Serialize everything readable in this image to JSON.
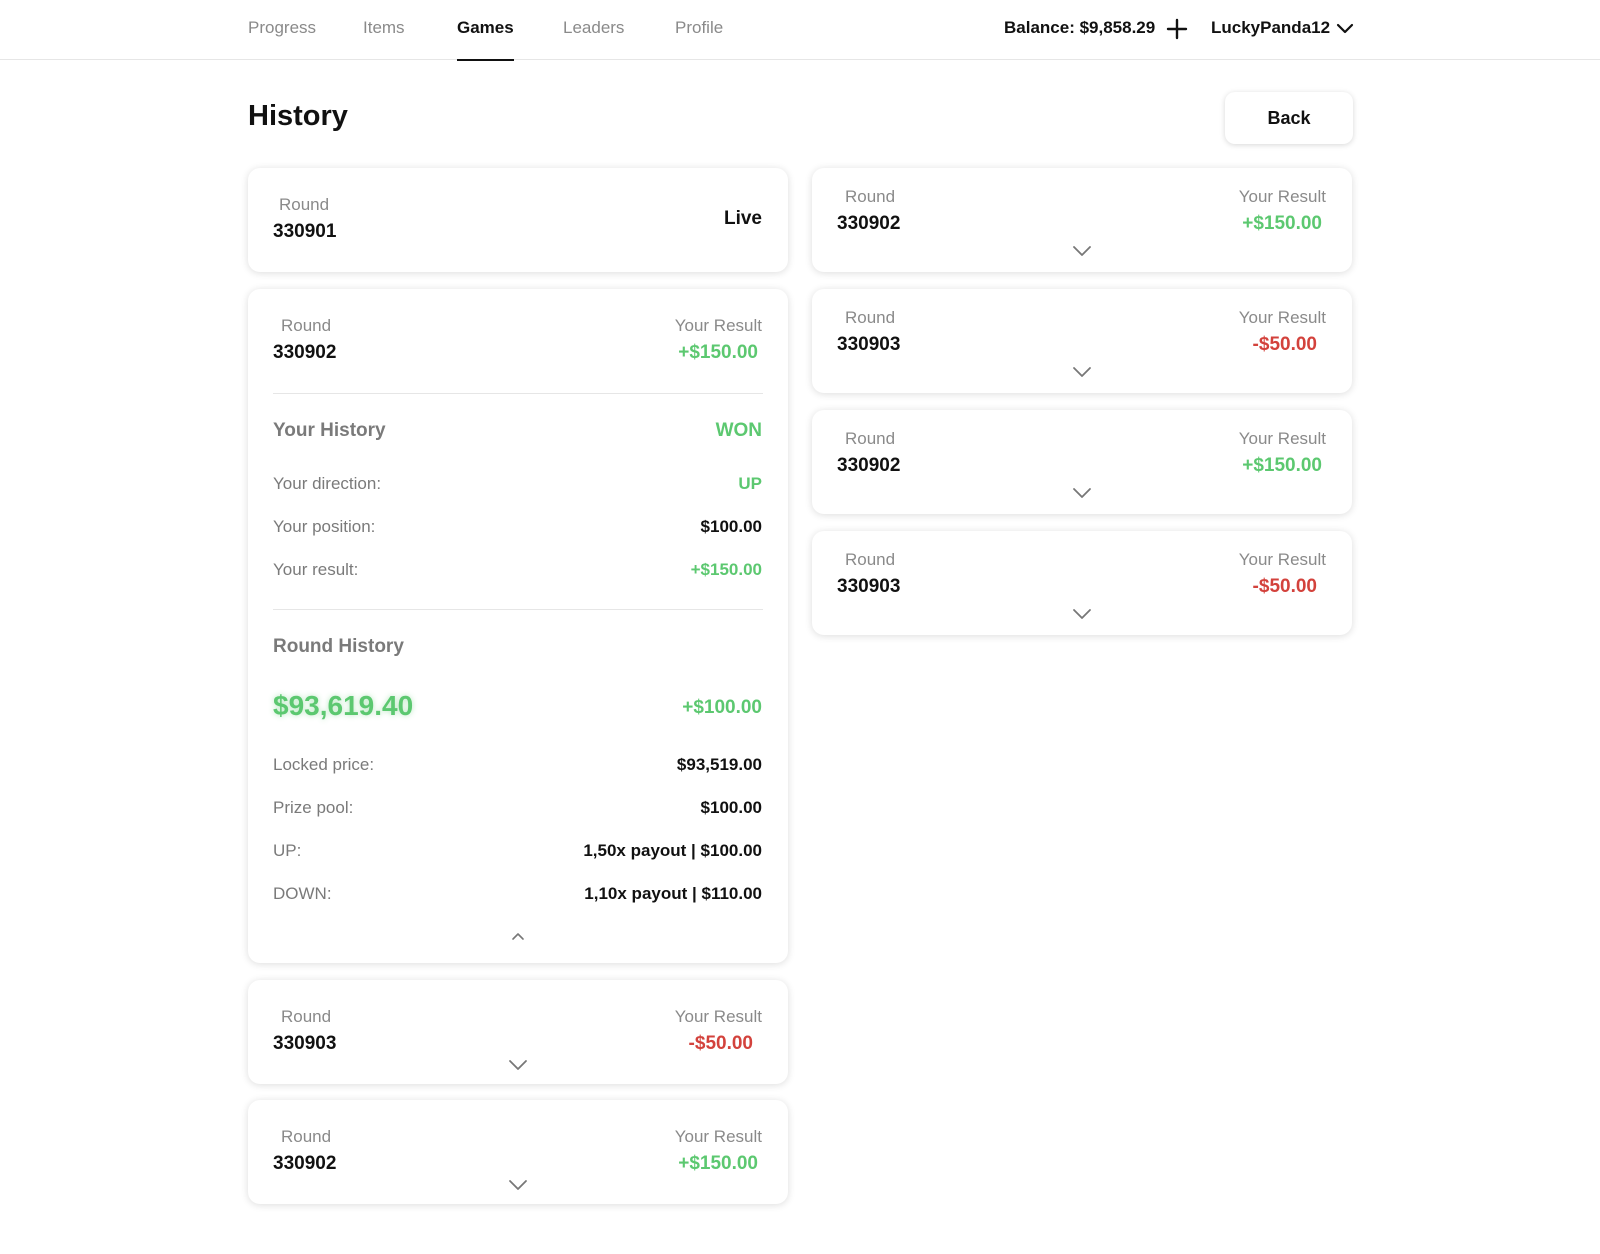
{
  "colors": {
    "positive": "#5cc870",
    "negative": "#d3423c",
    "text": "#111111",
    "muted": "#8a8a8a"
  },
  "nav": {
    "tabs": [
      {
        "label": "Progress"
      },
      {
        "label": "Items"
      },
      {
        "label": "Games",
        "active": true
      },
      {
        "label": "Leaders"
      },
      {
        "label": "Profile"
      }
    ],
    "balance": "Balance: $9,858.29",
    "username": "LuckyPanda12"
  },
  "header": {
    "title": "History",
    "back_label": "Back"
  },
  "labels": {
    "round": "Round",
    "your_result": "Your Result"
  },
  "live_card": {
    "round": "330901",
    "status": "Live"
  },
  "expanded_card": {
    "round": "330902",
    "result": "+$150.00",
    "your_history": {
      "title": "Your History",
      "outcome": "WON",
      "rows": [
        {
          "label": "Your direction:",
          "value": "UP"
        },
        {
          "label": "Your position:",
          "value": "$100.00"
        },
        {
          "label": "Your result:",
          "value": "+$150.00"
        }
      ]
    },
    "round_history": {
      "title": "Round History",
      "price": "$93,619.40",
      "change": "+$100.00",
      "rows": [
        {
          "label": "Locked price:",
          "value": "$93,519.00"
        },
        {
          "label": "Prize pool:",
          "value": "$100.00"
        },
        {
          "label": "UP:",
          "value": "1,50x payout | $100.00"
        },
        {
          "label": "DOWN:",
          "value": "1,10x payout | $110.00"
        }
      ]
    }
  },
  "left_cards": [
    {
      "round": "330903",
      "result": "-$50.00",
      "positive": false
    },
    {
      "round": "330902",
      "result": "+$150.00",
      "positive": true
    }
  ],
  "right_cards": [
    {
      "round": "330902",
      "result": "+$150.00",
      "positive": true
    },
    {
      "round": "330903",
      "result": "-$50.00",
      "positive": false
    },
    {
      "round": "330902",
      "result": "+$150.00",
      "positive": true
    },
    {
      "round": "330903",
      "result": "-$50.00",
      "positive": false
    }
  ]
}
